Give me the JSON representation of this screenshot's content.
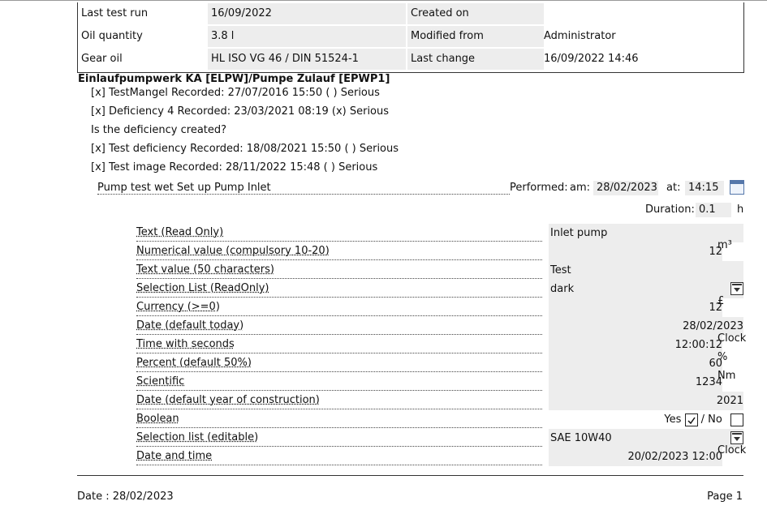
{
  "info_table": {
    "rows": [
      {
        "label1": "Last test run",
        "value1": "16/09/2022",
        "label2": "Created on",
        "value2": ""
      },
      {
        "label1": "Oil quantity",
        "value1": "3.8 l",
        "label2": "Modified from",
        "value2": "Administrator"
      },
      {
        "label1": "Gear oil",
        "value1": "HL ISO VG 46 / DIN 51524-1",
        "label2": "Last change",
        "value2": "16/09/2022 14:46"
      }
    ]
  },
  "heading": "Einlaufpumpwerk KA [ELPW]/Pumpe Zulauf [EPWP1]",
  "deficiencies": [
    "[x] TestMangel Recorded: 27/07/2016 15:50 ( ) Serious",
    "[x] Deficiency 4 Recorded: 23/03/2021 08:19 (x) Serious",
    "Is the deficiency created?",
    "[x] Test deficiency Recorded: 18/08/2021 15:50 ( ) Serious",
    "[x] Test image Recorded: 28/11/2022 15:48 ( ) Serious"
  ],
  "test": {
    "name": "Pump test wet Set up Pump Inlet",
    "performed_label": "Performed:",
    "am_label": "am:",
    "date": "28/02/2023",
    "at_label": "at:",
    "time": "14:15",
    "duration_label": "Duration:",
    "duration": "0.1",
    "duration_unit": "h"
  },
  "fields": [
    {
      "label": "Text (Read Only)",
      "value": "Inlet pump",
      "unit": "",
      "align": "left"
    },
    {
      "label": "Numerical value (compulsory 10-20)",
      "value": "12",
      "unit": "m³",
      "align": "right"
    },
    {
      "label": "Text value (50 characters)",
      "value": "Test",
      "unit": "",
      "align": "left"
    },
    {
      "label": "Selection List (ReadOnly)",
      "value": "dark",
      "unit": "",
      "align": "left",
      "dropdown": true
    },
    {
      "label": "Currency (>=0)",
      "value": "12",
      "unit": "£",
      "align": "right"
    },
    {
      "label": "Date (default today)",
      "value": "28/02/2023",
      "unit": "",
      "align": "right"
    },
    {
      "label": "Time with seconds",
      "value": "12:00:12",
      "unit": "Clock",
      "align": "right"
    },
    {
      "label": "Percent (default 50%)",
      "value": "60",
      "unit": "%",
      "align": "right"
    },
    {
      "label": "Scientific",
      "value": "1234",
      "unit": "Nm",
      "align": "right"
    },
    {
      "label": "Date (default year of construction)",
      "value": "2021",
      "unit": "",
      "align": "right"
    },
    {
      "label": "Boolean",
      "value": "",
      "unit": "",
      "align": "bool"
    },
    {
      "label": "Selection list (editable)",
      "value": "SAE 10W40",
      "unit": "",
      "align": "left",
      "dropdown": true
    },
    {
      "label": "Date and time",
      "value": "20/02/2023 12:00",
      "unit": "Clock",
      "align": "right"
    }
  ],
  "boolean": {
    "yes_label": "Yes",
    "no_label": "/ No",
    "yes_checked": true,
    "no_checked": false
  },
  "footer": {
    "date": "Date : 28/02/2023",
    "page": "Page 1"
  }
}
